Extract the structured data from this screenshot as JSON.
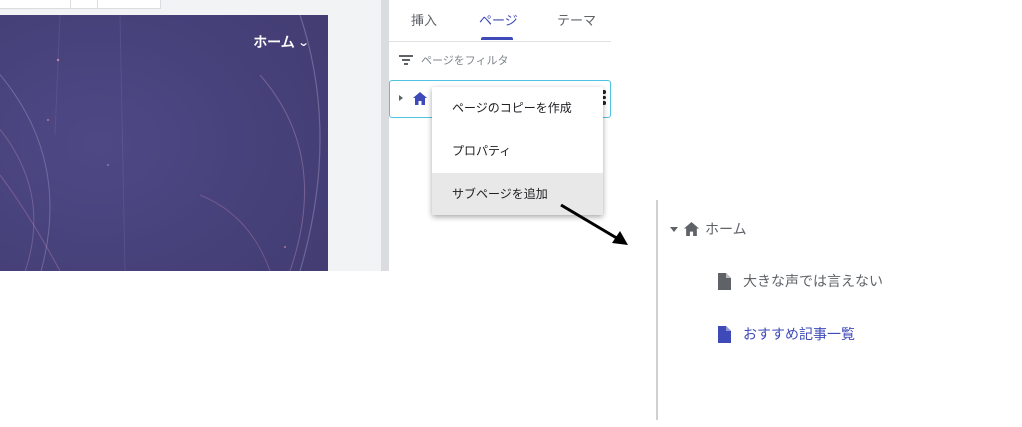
{
  "site_preview": {
    "nav_label": "ホーム"
  },
  "panel": {
    "tabs": [
      {
        "label": "挿入",
        "active": false
      },
      {
        "label": "ページ",
        "active": true
      },
      {
        "label": "テーマ",
        "active": false
      }
    ],
    "filter_placeholder": "ページをフィルタ",
    "page_row_icon": "home-icon"
  },
  "context_menu": {
    "items": [
      {
        "label": "ページのコピーを作成",
        "highlighted": false
      },
      {
        "label": "プロパティ",
        "highlighted": false
      },
      {
        "label": "サブページを追加",
        "highlighted": true
      }
    ]
  },
  "result_tree": {
    "root": {
      "label": "ホーム",
      "icon": "home-icon",
      "expanded": true
    },
    "children": [
      {
        "label": "大きな声では言えない",
        "icon": "page-icon",
        "active": false
      },
      {
        "label": "おすすめ記事一覧",
        "icon": "page-icon",
        "active": true
      }
    ]
  },
  "colors": {
    "accent": "#3d4ab8",
    "hero_background": "#47417a",
    "row_outline": "#4fc3e0",
    "muted_text": "#5f6368"
  }
}
